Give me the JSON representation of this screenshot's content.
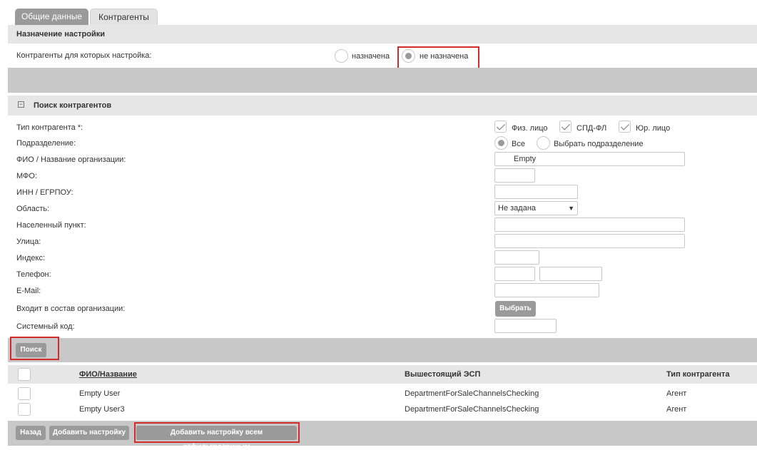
{
  "tabs": {
    "general": "Общие данные",
    "counterparties": "Контрагенты"
  },
  "assignment": {
    "title": "Назначение настройки",
    "label": "Контрагенты для которых настройка:",
    "option_assigned": "назначена",
    "option_not_assigned": "не назначена"
  },
  "search": {
    "title": "Поиск контрагентов",
    "collapse_icon": "minus-square-icon",
    "type_label": "Тип контрагента *:",
    "type_individual": "Физ. лицо",
    "type_spd": "СПД-ФЛ",
    "type_legal": "Юр. лицо",
    "department_label": "Подразделение:",
    "department_all": "Все",
    "department_choose": "Выбрать подразделение",
    "name_label": "ФИО / Название организации:",
    "name_value": "Empty",
    "mfo_label": "МФО:",
    "inn_label": "ИНН / ЕГРПОУ:",
    "region_label": "Область:",
    "region_value": "Не задана",
    "city_label": "Населенный пункт:",
    "street_label": "Улица:",
    "index_label": "Индекс:",
    "phone_label": "Телефон:",
    "email_label": "E-Mail:",
    "org_label": "Входит в состав организации:",
    "choose_button": "Выбрать",
    "syscode_label": "Системный код:",
    "search_button": "Поиск"
  },
  "table": {
    "columns": [
      "ФИО/Название",
      "Вышестоящий ЭСП",
      "Тип контрагента"
    ],
    "rows": [
      {
        "name": "Empty User",
        "parent": "DepartmentForSaleChannelsChecking",
        "type": "Агент"
      },
      {
        "name": "Empty User3",
        "parent": "DepartmentForSaleChannelsChecking",
        "type": "Агент"
      }
    ]
  },
  "footer": {
    "back": "Назад",
    "add_setting": "Добавить настройку",
    "add_setting_all": "Добавить настройку всем отфильтрованным"
  },
  "colors": {
    "highlight": "#d42a2a",
    "button": "#9a9a9a",
    "panel": "#e6e6e6",
    "panel_dark": "#c8c8c8"
  }
}
